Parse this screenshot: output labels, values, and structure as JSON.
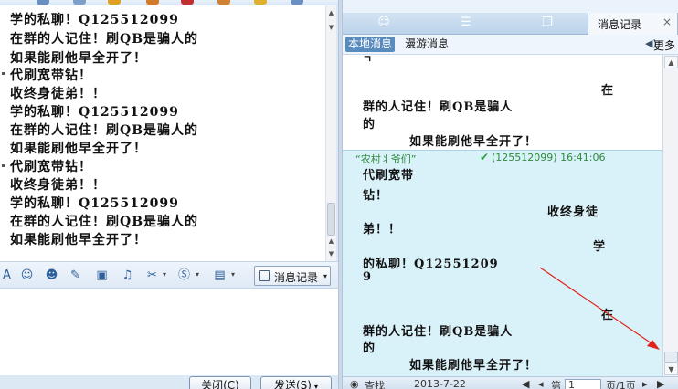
{
  "chat": {
    "lines": [
      "学的私聊！Q125512099",
      "在群的人记住！刷QB是骗人的",
      "如果能刷他早全开了！",
      "代刷宽带钻！",
      "收终身徒弟！！",
      "学的私聊！Q125512099",
      "在群的人记住！刷QB是骗人的",
      "如果能刷他早全开了！",
      "代刷宽带钻！",
      "收终身徒弟！！",
      "学的私聊！Q125512099",
      "在群的人记住！刷QB是骗人的",
      "如果能刷他早全开了！"
    ]
  },
  "toolbar": {
    "icons": [
      "font-icon",
      "emoji-icon",
      "avatar-icon",
      "edit-icon",
      "image-icon",
      "music-icon",
      "scissors-icon",
      "flash-icon",
      "screen-icon"
    ],
    "message_record_label": "消息记录"
  },
  "buttons": {
    "close_label": "关闭(C)",
    "send_label": "发送(S)"
  },
  "right_panel": {
    "active_tab_label": "消息记录",
    "close_glyph": "×",
    "subtabs": {
      "local": "本地消息",
      "roam": "漫游消息",
      "more": "更多"
    },
    "history": {
      "first_block": [
        "在",
        "群的人记住！刷QB是骗人",
        "的",
        "如果能刷他早全开了！"
      ],
      "sender_name": "“农村丬爷们”",
      "sender_meta": "(125512099) 16:41:06",
      "second_block": [
        "代刷宽带",
        "钻！",
        "收终身徒",
        "弟！！",
        "学",
        "的私聊！Q12551209",
        "9",
        "在",
        "群的人记住！刷QB是骗人",
        "的",
        "如果能刷他早全开了！"
      ]
    },
    "bottom": {
      "search": "查找",
      "date": "2013-7-22",
      "page_prefix": "第",
      "page_value": "1",
      "page_suffix": "页/1页"
    }
  },
  "colors": {
    "accent": "#5a8bbd",
    "history_highlight": "#d9f1f8",
    "sender_green": "#2e8b3e",
    "annotation_red": "#e0241b"
  }
}
